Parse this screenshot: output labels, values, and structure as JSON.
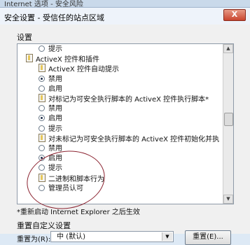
{
  "window": {
    "outer_title": "Internet 选项 - 安全风险"
  },
  "dialog": {
    "title": "安全设置 - 受信任的站点区域",
    "close_glyph": "X",
    "settings_label": "设置",
    "tree": [
      {
        "text": "提示",
        "kind": "radio",
        "checked": false,
        "indent": 1
      },
      {
        "text": "ActiveX 控件和插件",
        "kind": "doc",
        "indent": 0
      },
      {
        "text": "ActiveX 控件自动提示",
        "kind": "doc",
        "indent": 1
      },
      {
        "text": "禁用",
        "kind": "radio",
        "checked": true,
        "indent": 1
      },
      {
        "text": "启用",
        "kind": "radio",
        "checked": false,
        "indent": 1
      },
      {
        "text": "对标记为可安全执行脚本的 ActiveX 控件执行脚本*",
        "kind": "doc",
        "indent": 1
      },
      {
        "text": "禁用",
        "kind": "radio",
        "checked": false,
        "indent": 1
      },
      {
        "text": "启用",
        "kind": "radio",
        "checked": true,
        "indent": 1
      },
      {
        "text": "提示",
        "kind": "radio",
        "checked": false,
        "indent": 1
      },
      {
        "text": "对未标记为可安全执行脚本的 ActiveX 控件初始化并执",
        "kind": "doc",
        "indent": 1
      },
      {
        "text": "禁用",
        "kind": "radio",
        "checked": false,
        "indent": 1
      },
      {
        "text": "启用",
        "kind": "radio",
        "checked": true,
        "indent": 1
      },
      {
        "text": "提示",
        "kind": "radio",
        "checked": false,
        "indent": 1
      },
      {
        "text": "二进制和脚本行为",
        "kind": "doc",
        "indent": 1
      },
      {
        "text": "管理员认可",
        "kind": "radio",
        "checked": false,
        "indent": 1
      }
    ],
    "restart_note": "*重新启动 Internet Explorer 之后生效",
    "reset_group_label": "重置自定义设置",
    "reset_to_label": "重置为(R):",
    "reset_level_value": "中 (默认)",
    "reset_button_label": "重置(E)..."
  },
  "icons": {
    "scroll_up": "▲",
    "scroll_down": "▼",
    "dropdown_arrow": "▼"
  }
}
